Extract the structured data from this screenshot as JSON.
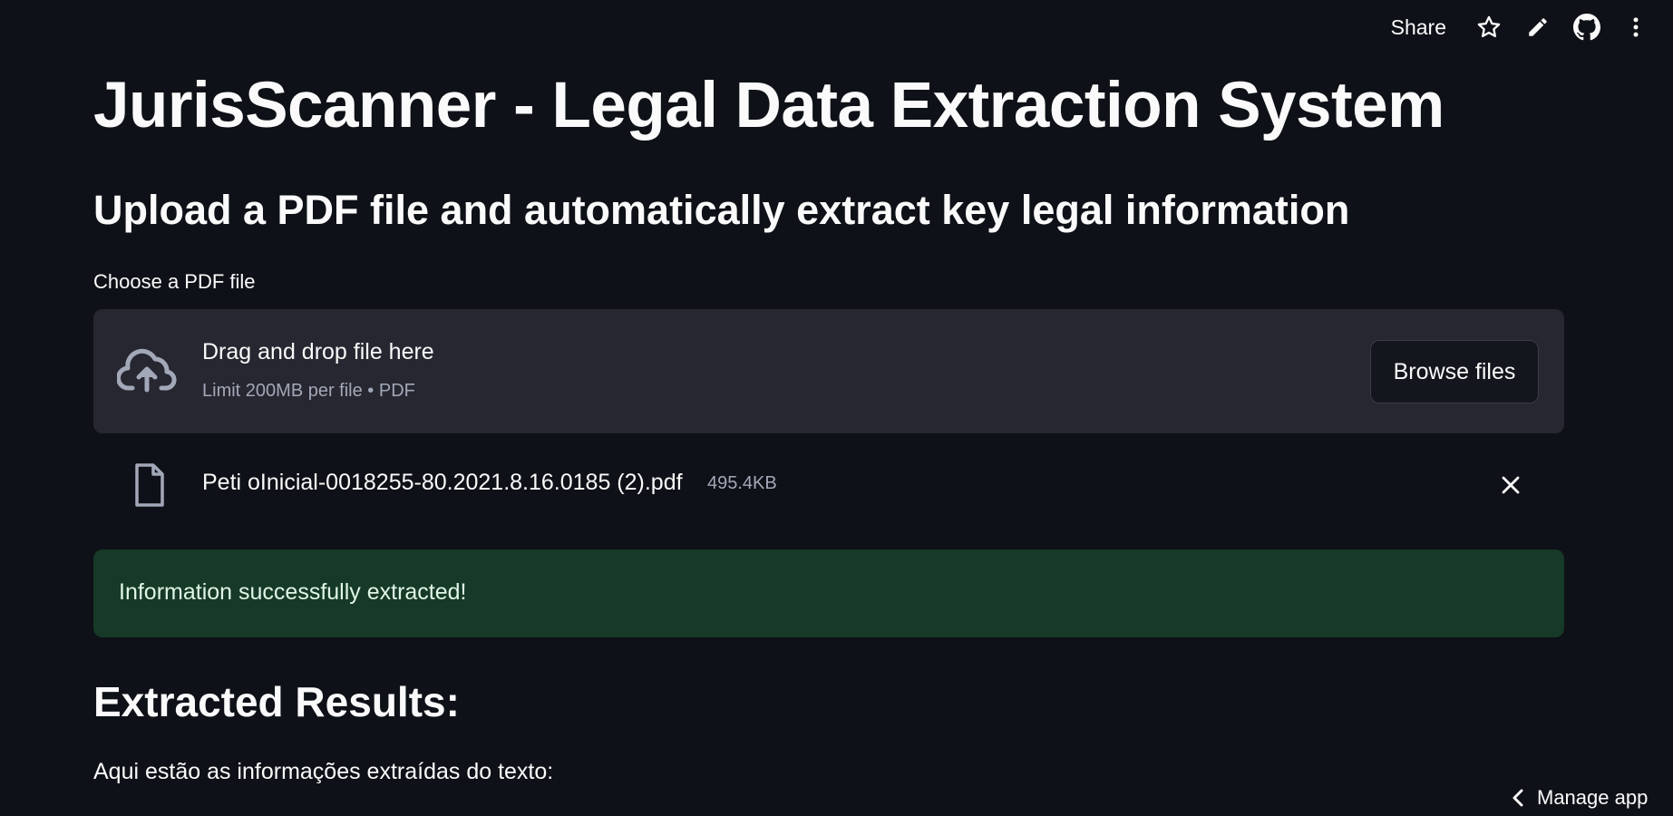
{
  "toolbar": {
    "share_label": "Share",
    "icons": [
      "star-icon",
      "pencil-icon",
      "github-icon",
      "more-vertical-icon"
    ]
  },
  "page": {
    "title": "JurisScanner - Legal Data Extraction System",
    "subtitle": "Upload a PDF file and automatically extract key legal information"
  },
  "uploader": {
    "label": "Choose a PDF file",
    "drop_text": "Drag and drop file here",
    "limit_text": "Limit 200MB per file • PDF",
    "browse_label": "Browse files",
    "file": {
      "name": "Peti oInicial-0018255-80.2021.8.16.0185 (2).pdf",
      "size": "495.4KB"
    }
  },
  "alert": {
    "text": "Information successfully extracted!",
    "color": "#173928"
  },
  "results": {
    "heading": "Extracted Results:",
    "intro": "Aqui estão as informações extraídas do texto:"
  },
  "manage_app": {
    "label": "Manage app"
  },
  "colors": {
    "background": "#0e1117",
    "panel": "#262730",
    "success_bg": "#173928",
    "muted_text": "#a3a8b8"
  }
}
